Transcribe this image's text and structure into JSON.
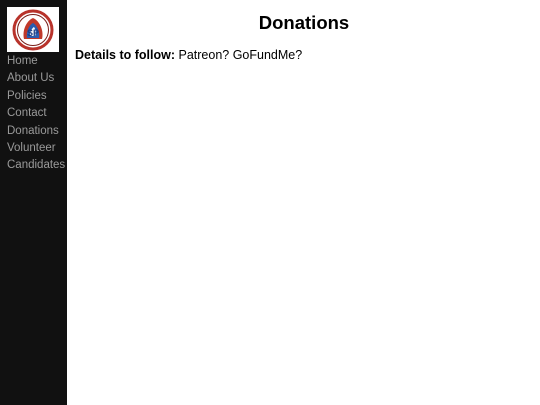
{
  "sidebar": {
    "logo_icon": "party-logo-icon",
    "items": [
      {
        "label": "Home"
      },
      {
        "label": "About Us"
      },
      {
        "label": "Policies"
      },
      {
        "label": "Contact"
      },
      {
        "label": "Donations"
      },
      {
        "label": "Volunteer"
      },
      {
        "label": "Candidates"
      }
    ]
  },
  "main": {
    "title": "Donations",
    "details_label": "Details to follow:",
    "details_text": "Patreon? GoFundMe?"
  },
  "colors": {
    "sidebar_bg": "#111111",
    "nav_text": "#9a9a9a",
    "logo_ring": "#c0392b",
    "logo_blue": "#2a5db0"
  }
}
